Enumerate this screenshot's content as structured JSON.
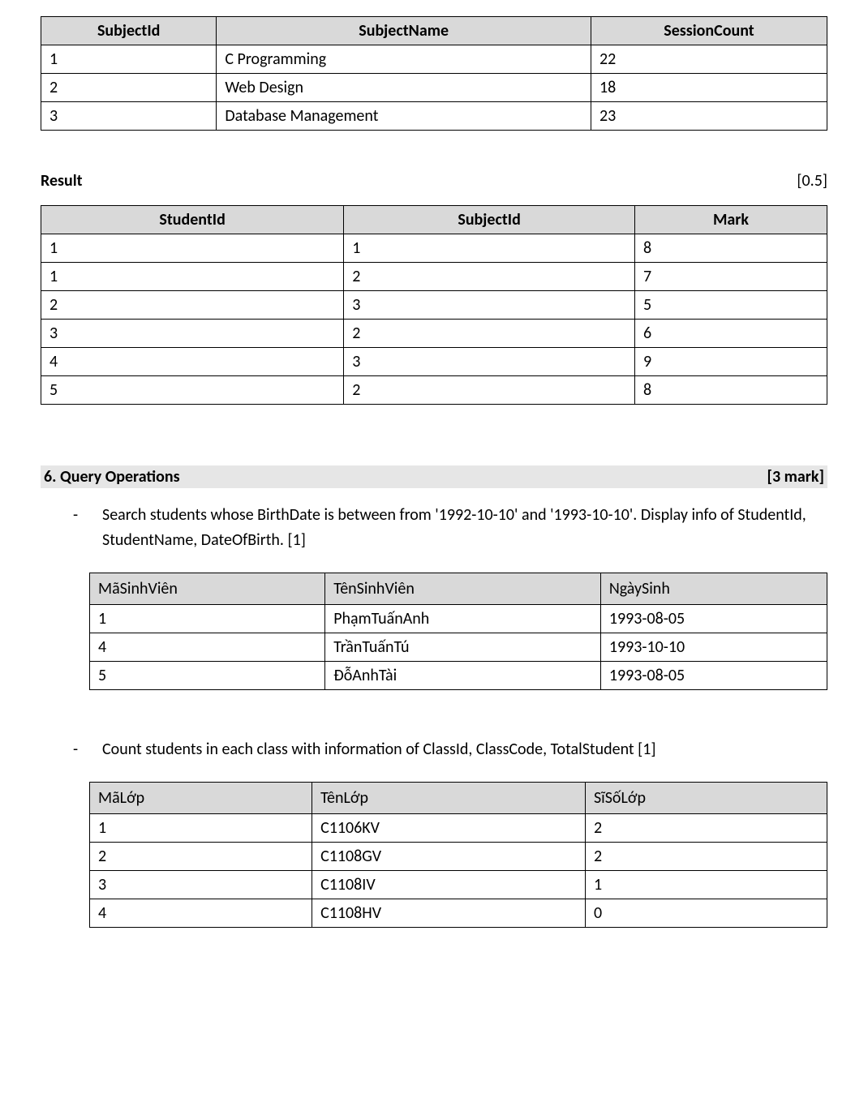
{
  "table_subject": {
    "headers": [
      "SubjectId",
      "SubjectName",
      "SessionCount"
    ],
    "rows": [
      [
        "1",
        "C Programming",
        "22"
      ],
      [
        "2",
        "Web Design",
        "18"
      ],
      [
        "3",
        "Database Management",
        "23"
      ]
    ]
  },
  "result_section": {
    "title": "Result",
    "mark": "[0.5]"
  },
  "table_result": {
    "headers": [
      "StudentId",
      "SubjectId",
      "Mark"
    ],
    "rows": [
      [
        "1",
        "1",
        "8"
      ],
      [
        "1",
        "2",
        "7"
      ],
      [
        "2",
        "3",
        "5"
      ],
      [
        "3",
        "2",
        "6"
      ],
      [
        "4",
        "3",
        "9"
      ],
      [
        "5",
        "2",
        "8"
      ]
    ]
  },
  "query_section": {
    "title": "6. Query Operations",
    "mark": "[3 mark]"
  },
  "bullet1": "Search students whose BirthDate is between  from '1992-10-10' and  '1993-10-10'. Display info of StudentId, StudentName, DateOfBirth.  [1]",
  "table_student": {
    "headers": [
      "MãSinhViên",
      "TênSinhViên",
      "NgàySinh"
    ],
    "rows": [
      [
        "1",
        "PhạmTuấnAnh",
        "1993-08-05"
      ],
      [
        "4",
        "TrầnTuấnTú",
        "1993-10-10"
      ],
      [
        "5",
        "ĐỗAnhTài",
        "1993-08-05"
      ]
    ]
  },
  "bullet2": "Count students in each class with information of ClassId, ClassCode, TotalStudent [1]",
  "table_class": {
    "headers": [
      "MãLớp",
      "TênLớp",
      "SĩSốLớp"
    ],
    "rows": [
      [
        "1",
        "C1106KV",
        "2"
      ],
      [
        "2",
        "C1108GV",
        "2"
      ],
      [
        "3",
        "C1108IV",
        "1"
      ],
      [
        "4",
        "C1108HV",
        "0"
      ]
    ]
  }
}
